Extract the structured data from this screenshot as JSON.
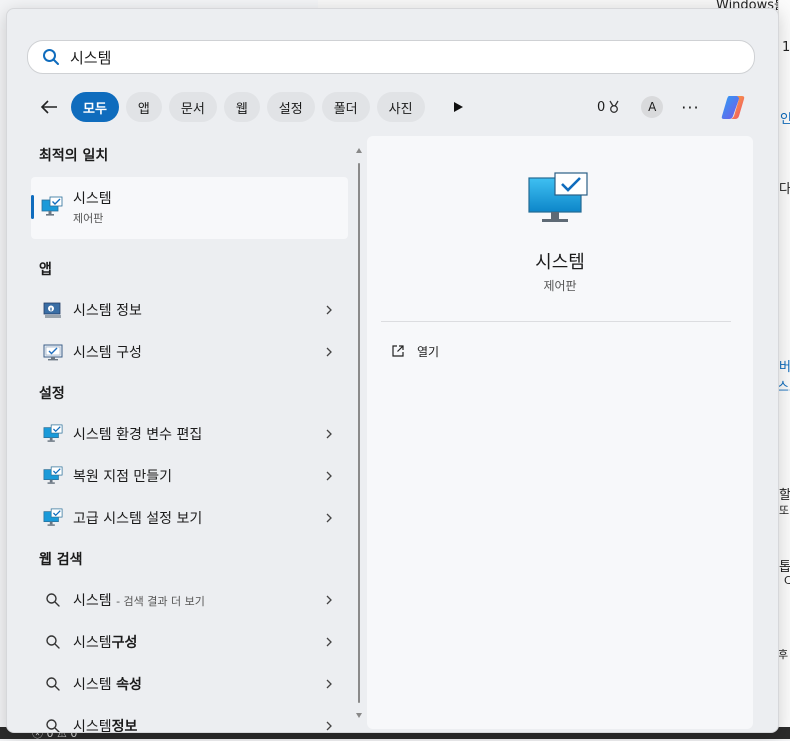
{
  "search": {
    "query": "시스템"
  },
  "filters": {
    "chips": [
      "모두",
      "앱",
      "문서",
      "웹",
      "설정",
      "폴더",
      "사진"
    ],
    "active_index": 0
  },
  "toolbar": {
    "points": "0",
    "avatar_letter": "A",
    "more_label": "···"
  },
  "sections": {
    "best_match": "최적의 일치",
    "apps": "앱",
    "settings": "설정",
    "web": "웹 검색"
  },
  "best_match": {
    "title": "시스템",
    "subtitle": "제어판"
  },
  "apps": [
    {
      "label": "시스템 정보",
      "icon": "system-info-icon"
    },
    {
      "label": "시스템 구성",
      "icon": "system-config-icon"
    }
  ],
  "settings": [
    {
      "label": "시스템 환경 변수 편집",
      "icon": "monitor-check-icon"
    },
    {
      "label": "복원 지점 만들기",
      "icon": "monitor-check-icon"
    },
    {
      "label": "고급 시스템 설정 보기",
      "icon": "monitor-check-icon"
    }
  ],
  "web": [
    {
      "prefix": "시스템",
      "bold": "",
      "hint": "- 검색 결과 더 보기"
    },
    {
      "prefix": "시스템",
      "bold": "구성",
      "hint": ""
    },
    {
      "prefix": "시스템 ",
      "bold": "속성",
      "hint": ""
    },
    {
      "prefix": "시스템",
      "bold": "정보",
      "hint": ""
    }
  ],
  "detail": {
    "title": "시스템",
    "subtitle": "제어판",
    "action_label": "열기"
  },
  "background": {
    "top_text": "Windows를",
    "right_texts": [
      "1",
      "인",
      "다음",
      "버",
      "스포",
      "할",
      "또",
      "톱",
      "C",
      "후"
    ],
    "bottom_text": "ⓧ 0 ⚠ 0"
  },
  "colors": {
    "accent": "#0f6cbd",
    "panel_bg": "#eceef1",
    "card_bg": "#f7f8fa"
  }
}
